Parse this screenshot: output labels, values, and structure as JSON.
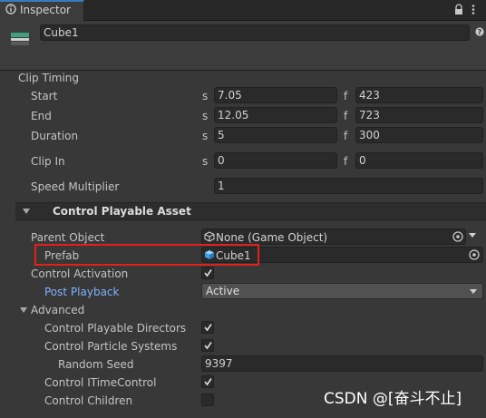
{
  "tab": {
    "label": "Inspector",
    "icon": "info-icon"
  },
  "header": {
    "name_value": "Cube1",
    "icon": "game-object-icon"
  },
  "clip_timing": {
    "title": "Clip Timing",
    "seconds_unit": "s",
    "frames_unit": "f",
    "rows": [
      {
        "label": "Start",
        "seconds": "7.05",
        "frames": "423"
      },
      {
        "label": "End",
        "seconds": "12.05",
        "frames": "723"
      },
      {
        "label": "Duration",
        "seconds": "5",
        "frames": "300"
      },
      {
        "label": "Clip In",
        "seconds": "0",
        "frames": "0"
      }
    ],
    "speed_label": "Speed Multiplier",
    "speed_value": "1"
  },
  "control_playable": {
    "title": "Control Playable Asset",
    "parent_object_label": "Parent Object",
    "parent_object_value": "None (Game Object)",
    "prefab_label": "Prefab",
    "prefab_value": "Cube1",
    "control_activation_label": "Control Activation",
    "control_activation_checked": true,
    "post_playback_label": "Post Playback",
    "post_playback_value": "Active",
    "advanced_label": "Advanced",
    "control_directors_label": "Control Playable Directors",
    "control_directors_checked": true,
    "control_particles_label": "Control Particle Systems",
    "control_particles_checked": true,
    "random_seed_label": "Random Seed",
    "random_seed_value": "9397",
    "control_itime_label": "Control ITimeControl",
    "control_itime_checked": true,
    "control_children_label": "Control Children",
    "control_children_checked": false
  },
  "watermark": "CSDN @[奋斗不止]",
  "colors": {
    "highlight_box": "#e2201c",
    "link_blue": "#7fb2ff",
    "tab_accent": "#3a79bb"
  }
}
